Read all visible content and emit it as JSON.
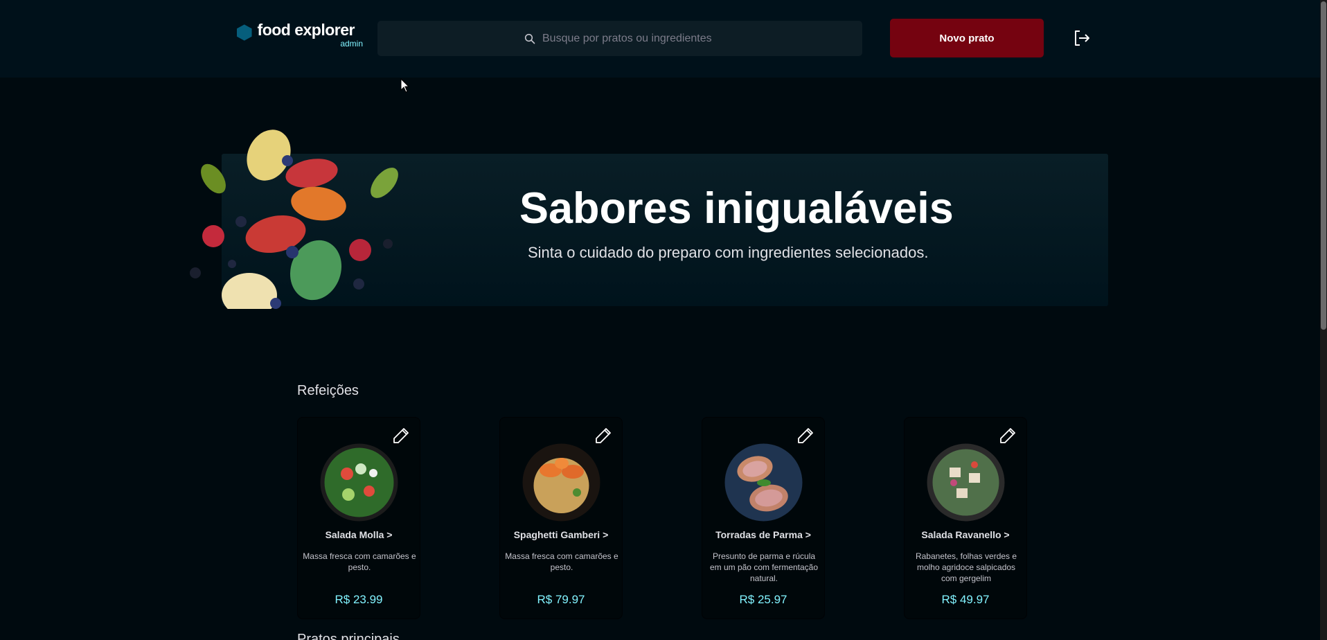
{
  "header": {
    "logo_name": "food explorer",
    "logo_role": "admin",
    "search_placeholder": "Busque por pratos ou ingredientes",
    "new_button": "Novo prato",
    "logout_icon": "sign-out-icon"
  },
  "banner": {
    "title": "Sabores inigualáveis",
    "subtitle": "Sinta o cuidado do preparo com ingredientes selecionados."
  },
  "sections": [
    {
      "title": "Refeições",
      "dishes": [
        {
          "name": "Salada Molla >",
          "description": "Massa fresca com camarões e pesto.",
          "price": "R$ 23.99"
        },
        {
          "name": "Spaghetti Gamberi >",
          "description": "Massa fresca com camarões e pesto.",
          "price": "R$ 79.97"
        },
        {
          "name": "Torradas de Parma >",
          "description": "Presunto de parma e rúcula em um pão com fermentação natural.",
          "price": "R$ 25.97"
        },
        {
          "name": "Salada Ravanello >",
          "description": "Rabanetes, folhas verdes e molho agridoce salpicados com gergelim",
          "price": "R$ 49.97"
        }
      ]
    },
    {
      "title": "Pratos principais"
    }
  ],
  "colors": {
    "accent_button": "#750310",
    "price": "#82f3ff",
    "logo_hex": "#065e7c"
  }
}
